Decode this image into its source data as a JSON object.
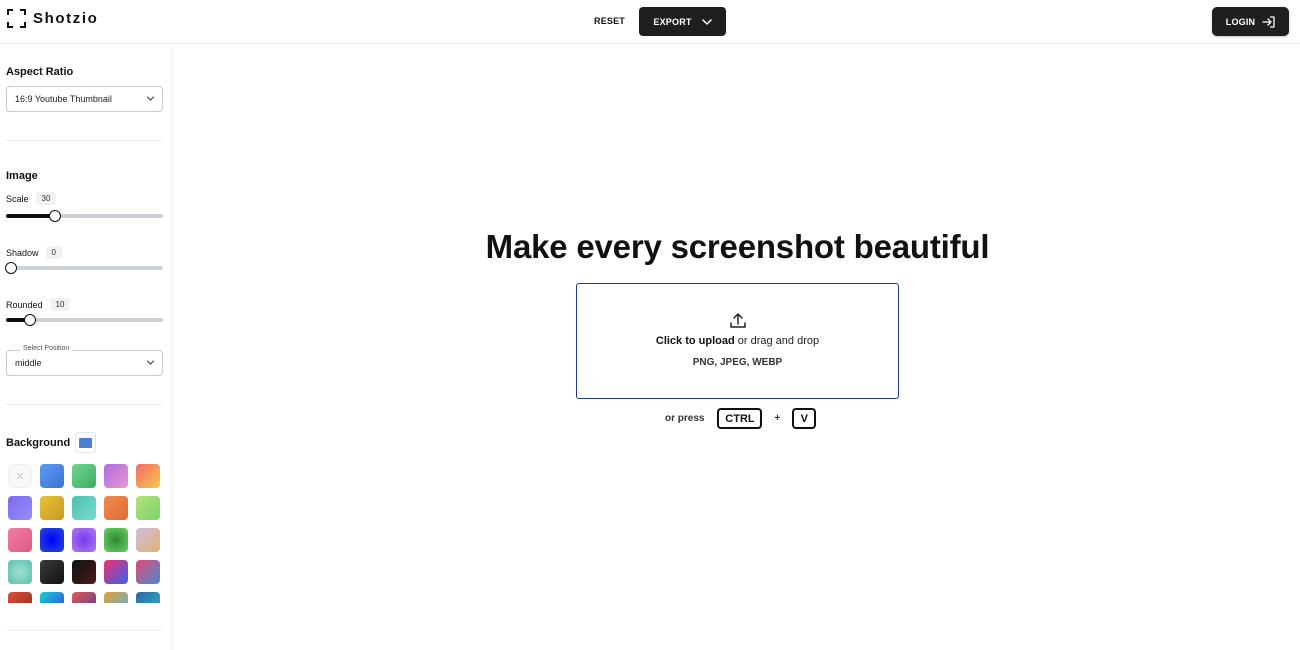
{
  "app": {
    "name": "Shotzio"
  },
  "header": {
    "reset_label": "RESET",
    "export_label": "EXPORT",
    "login_label": "LOGIN"
  },
  "sidebar": {
    "aspect_ratio": {
      "title": "Aspect Ratio",
      "selected": "16:9 Youtube Thumbnail"
    },
    "image": {
      "title": "Image",
      "scale": {
        "label": "Scale",
        "value": "30",
        "fraction": 0.3
      },
      "shadow": {
        "label": "Shadow",
        "value": "0",
        "fraction": 0
      },
      "rounded": {
        "label": "Rounded",
        "value": "10",
        "fraction": 0.13
      },
      "position": {
        "legend": "Select Position",
        "selected": "middle"
      }
    },
    "background": {
      "title": "Background",
      "current_color": "#4a7fd4",
      "swatches": [
        "none",
        "linear-gradient(135deg,#5b9bf0,#3a74d6)",
        "linear-gradient(135deg,#6fd48e,#3fae62)",
        "linear-gradient(135deg,#b06ae0,#e79ad0)",
        "linear-gradient(135deg,#f06a6a,#f7c948)",
        "linear-gradient(135deg,#7a6cf0,#9a8cf8)",
        "linear-gradient(135deg,#e7c23c,#c79a1c)",
        "linear-gradient(135deg,#4cc1b0,#7ad9d0)",
        "linear-gradient(135deg,#f08a4a,#e06a3a)",
        "linear-gradient(135deg,#b3e27a,#7ad36a)",
        "linear-gradient(135deg,#f07aa0,#e05a8a)",
        "radial-gradient(circle,#0000ff,#2a4cd0)",
        "radial-gradient(circle,#7a3af0,#b07af0)",
        "radial-gradient(circle,#2a8a2a,#6ad06a)",
        "linear-gradient(135deg,#d0c0e0,#e0b070)",
        "radial-gradient(circle,#a0e0d0,#5ac0b0)",
        "linear-gradient(135deg,#3a3a3a,#111111)",
        "linear-gradient(135deg,#111111,#4a1a1a)",
        "linear-gradient(135deg,#f0306a,#3a60f0)",
        "linear-gradient(135deg,#e04a7a,#4a8ad0)",
        "linear-gradient(135deg,#e0503a,#8a2a1a)",
        "linear-gradient(135deg,#1ad0d0,#3a3af0)",
        "linear-gradient(135deg,#e05a5a,#5a3a8a)",
        "linear-gradient(135deg,#e0a03a,#5ab0e0)",
        "linear-gradient(135deg,#2a6aa0,#3ab0d0)"
      ]
    }
  },
  "main": {
    "title": "Make every screenshot beautiful",
    "upload": {
      "cta": "Click to upload",
      "rest": " or drag and drop",
      "formats": "PNG, JPEG, WEBP"
    },
    "shortcut": {
      "prefix": "or press",
      "key1": "CTRL",
      "plus": "+",
      "key2": "V"
    }
  }
}
